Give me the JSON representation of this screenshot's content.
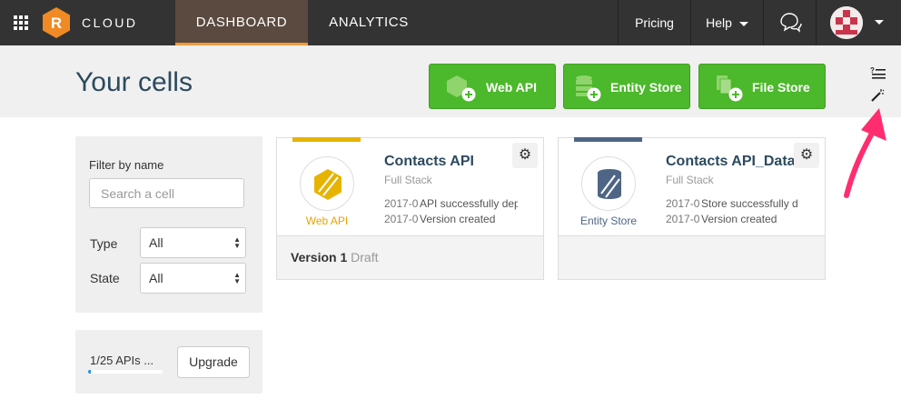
{
  "nav": {
    "brand": "CLOUD",
    "logo_letter": "R",
    "tabs": [
      {
        "label": "DASHBOARD",
        "active": true
      },
      {
        "label": "ANALYTICS",
        "active": false
      }
    ],
    "pricing": "Pricing",
    "help": "Help",
    "icons": {
      "apps": "apps-grid-icon",
      "chat": "chat-bubbles-icon"
    }
  },
  "header": {
    "title": "Your cells",
    "buttons": {
      "web_api": "Web API",
      "entity_store": "Entity Store",
      "file_store": "File Store"
    }
  },
  "filter": {
    "label": "Filter by name",
    "search_placeholder": "Search a cell",
    "type_label": "Type",
    "type_value": "All",
    "state_label": "State",
    "state_value": "All"
  },
  "quota": {
    "text": "1/25 APIs ...",
    "progress": 0.04,
    "upgrade": "Upgrade"
  },
  "cards": [
    {
      "name": "Contacts API",
      "stack": "Full Stack",
      "type": "Web API",
      "type_color": "#e6b400",
      "logs": [
        {
          "date": "2017-0",
          "msg": "API successfully dep"
        },
        {
          "date": "2017-0",
          "msg": "Version created"
        }
      ],
      "version_label": "Version 1",
      "version_state": "Draft"
    },
    {
      "name": "Contacts API_Data",
      "stack": "Full Stack",
      "type": "Entity Store",
      "type_color": "#4f6585",
      "logs": [
        {
          "date": "2017-0",
          "msg": "Store successfully d"
        },
        {
          "date": "2017-0",
          "msg": "Version created"
        }
      ]
    }
  ],
  "colors": {
    "accent_orange": "#f29b38",
    "button_green": "#4cb82b",
    "annotation_pink": "#ff2d6f"
  }
}
